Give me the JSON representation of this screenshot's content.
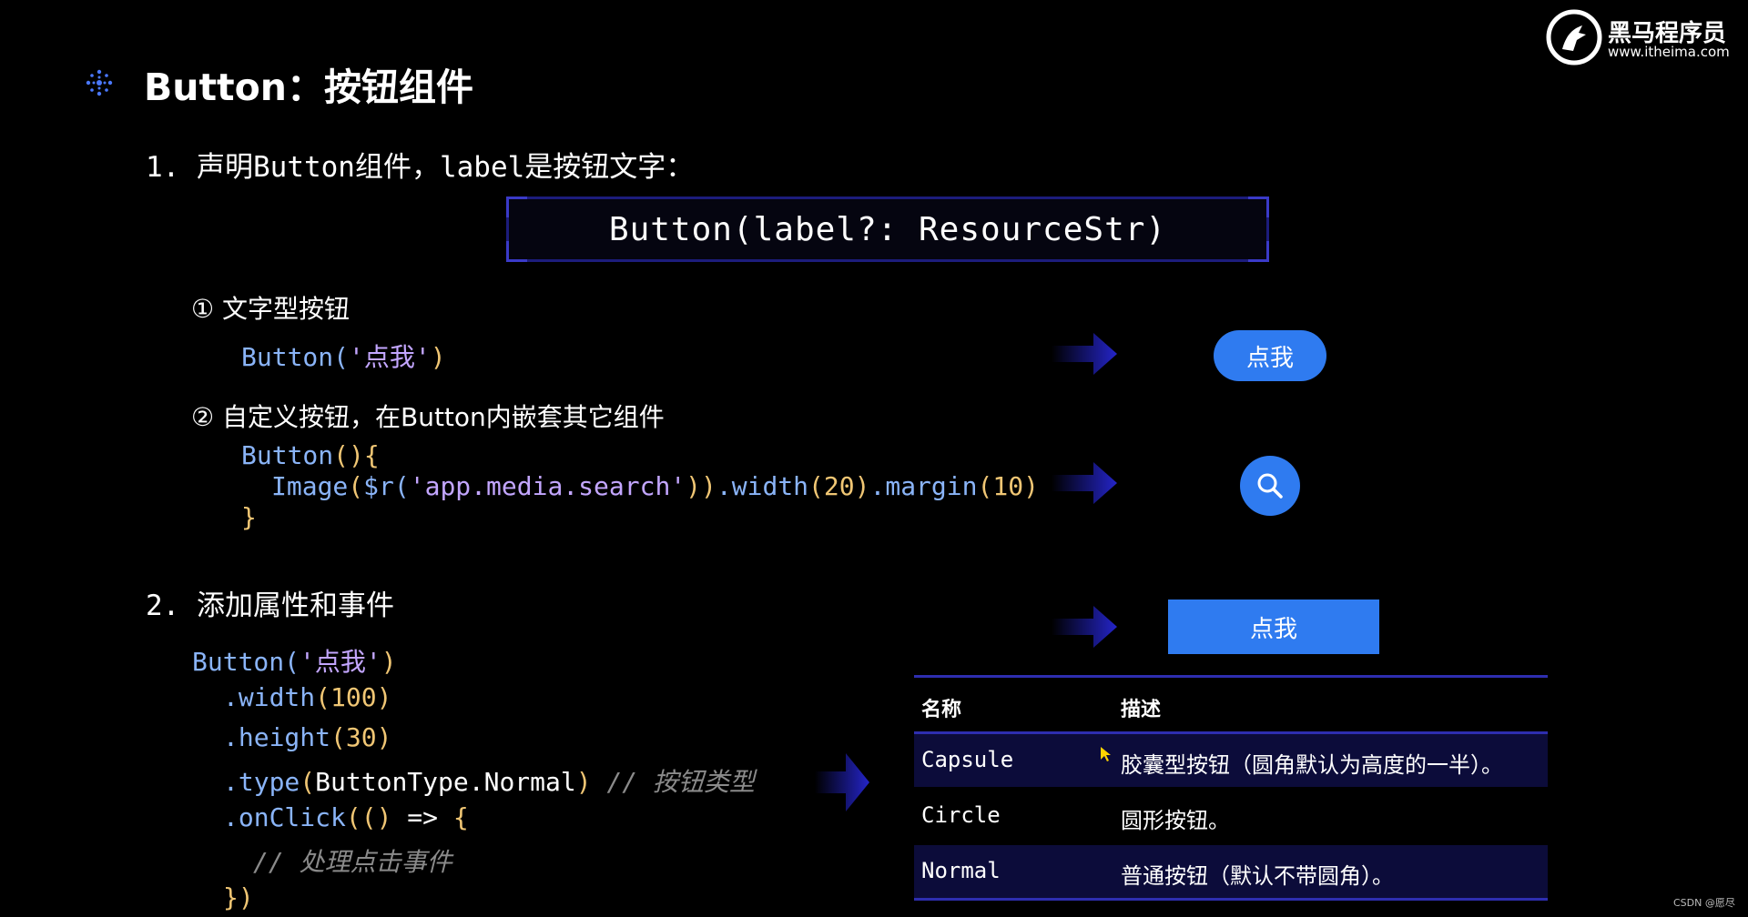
{
  "header": {
    "title": "Button：按钮组件",
    "title_icon": "snowflake-icon"
  },
  "logo": {
    "name_cn": "黑马程序员",
    "url": "www.itheima.com",
    "icon": "horse-logo-icon"
  },
  "section1": {
    "heading": "1. 声明Button组件，label是按钮文字：",
    "signature": "Button(label?: ResourceStr)",
    "item1": {
      "heading": "①  文字型按钮",
      "code_fn": "Button(",
      "code_str": "'点我'",
      "code_close": ")"
    },
    "item2": {
      "heading": "②  自定义按钮，在Button内嵌套其它组件",
      "line1_fn": "Button",
      "line1_pun": "(){",
      "line2_fn": "Image",
      "line2_pun1": "(",
      "line2_sr": "$r(",
      "line2_str": "'app.media.search'",
      "line2_pun2": "))",
      "line2_width": ".width",
      "line2_num1": "(20)",
      "line2_margin": ".margin",
      "line2_num2": "(10)",
      "line3": "}"
    }
  },
  "section2": {
    "heading": "2. 添加属性和事件",
    "code": {
      "l1_fn": "Button(",
      "l1_str": "'点我'",
      "l1_close": ")",
      "l2_fn": ".width",
      "l2_num": "(100)",
      "l3_fn": ".height",
      "l3_num": "(30)",
      "l4_fn": ".type",
      "l4_pun1": "(",
      "l4_val": "ButtonType.Normal",
      "l4_pun2": ")",
      "l4_cmt": "// 按钮类型",
      "l5_fn": ".onClick",
      "l5_pun": "(()",
      "l5_arrow": " => ",
      "l5_brace": "{",
      "l6_cmt": "// 处理点击事件",
      "l7": "})"
    }
  },
  "demo": {
    "capsule_label": "点我",
    "circle_icon": "search-icon",
    "normal_label": "点我"
  },
  "table": {
    "headers": [
      "名称",
      "描述"
    ],
    "rows": [
      {
        "name": "Capsule",
        "desc": "胶囊型按钮（圆角默认为高度的一半）。"
      },
      {
        "name": "Circle",
        "desc": "圆形按钮。"
      },
      {
        "name": "Normal",
        "desc": "普通按钮（默认不带圆角）。"
      }
    ]
  },
  "watermark": "CSDN @愿尽",
  "colors": {
    "accent_blue": "#2f7bf0",
    "arrow_blue": "#2424c8",
    "row_highlight": "#0c0c3a"
  }
}
